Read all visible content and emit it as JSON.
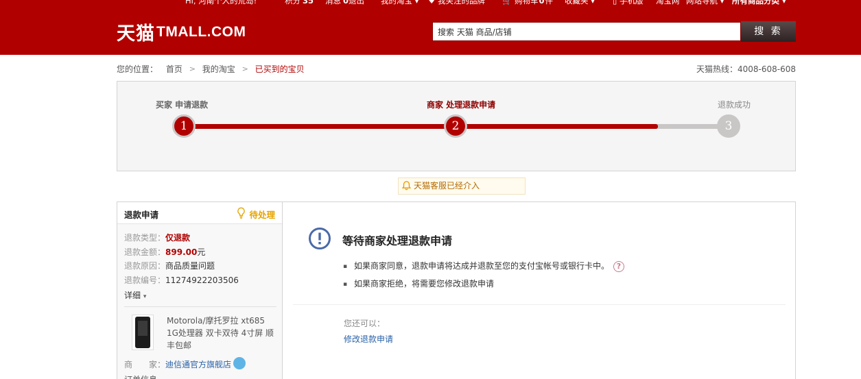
{
  "topbar": {
    "greeting": "Hi, 河南个人的荒岛!",
    "points_label": "积分",
    "points_value": "35",
    "messages_label": "消息",
    "messages_value": "0",
    "logout": "退出",
    "my_taobao": "我的淘宝",
    "fav_brands": "我关注的品牌",
    "cart_label": "购物车",
    "cart_count": "0",
    "cart_unit": "件",
    "favorites": "收藏夹",
    "mobile": "手机版",
    "taobao": "淘宝网",
    "site_nav": "网站导航",
    "all_categories": "所有商品分类"
  },
  "header": {
    "logo_cn": "天猫",
    "logo_en": "TMALL.COM",
    "search_placeholder": "搜索 天猫 商品/店铺",
    "search_button": "搜 索"
  },
  "breadcrumb": {
    "label": "您的位置：",
    "items": [
      "首页",
      "我的淘宝",
      "已买到的宝贝"
    ]
  },
  "hotline": "天猫热线：4008-608-608",
  "steps": [
    {
      "label": "买家 申请退款",
      "number": "1",
      "state": "done"
    },
    {
      "label": "商家 处理退款申请",
      "number": "2",
      "state": "active"
    },
    {
      "label": "退款成功",
      "number": "3",
      "state": "todo"
    }
  ],
  "progress_fraction": 0.87,
  "notice": "天猫客服已经介入",
  "refund": {
    "title": "退款申请",
    "status": "待处理",
    "type_label": "退款类型：",
    "type_value": "仅退款",
    "amount_label": "退款金额：",
    "amount_value": "899.00",
    "amount_unit": "元",
    "reason_label": "退款原因：",
    "reason_value": "商品质量问题",
    "number_label": "退款编号：",
    "number_value": "11274922203506",
    "detail_link": "详细",
    "product_name": "Motorola/摩托罗拉 xt685 1G处理器 双卡双待 4寸屏 顺丰包邮",
    "seller_label": "商　　家：",
    "seller_name": "迪信通官方旗舰店",
    "more_info": "订单信息"
  },
  "main": {
    "title": "等待商家处理退款申请",
    "bullet1": "如果商家同意，退款申请将达成并退款至您的支付宝帐号或银行卡中。",
    "bullet2": "如果商家拒绝，将需要您修改退款申请",
    "can_also": "您还可以：",
    "modify_link": "修改退款申请"
  },
  "colors": {
    "brand_red": "#b10000",
    "status_orange": "#e6a400",
    "link_blue": "#2a62a8",
    "info_blue": "#4a6aa8"
  }
}
